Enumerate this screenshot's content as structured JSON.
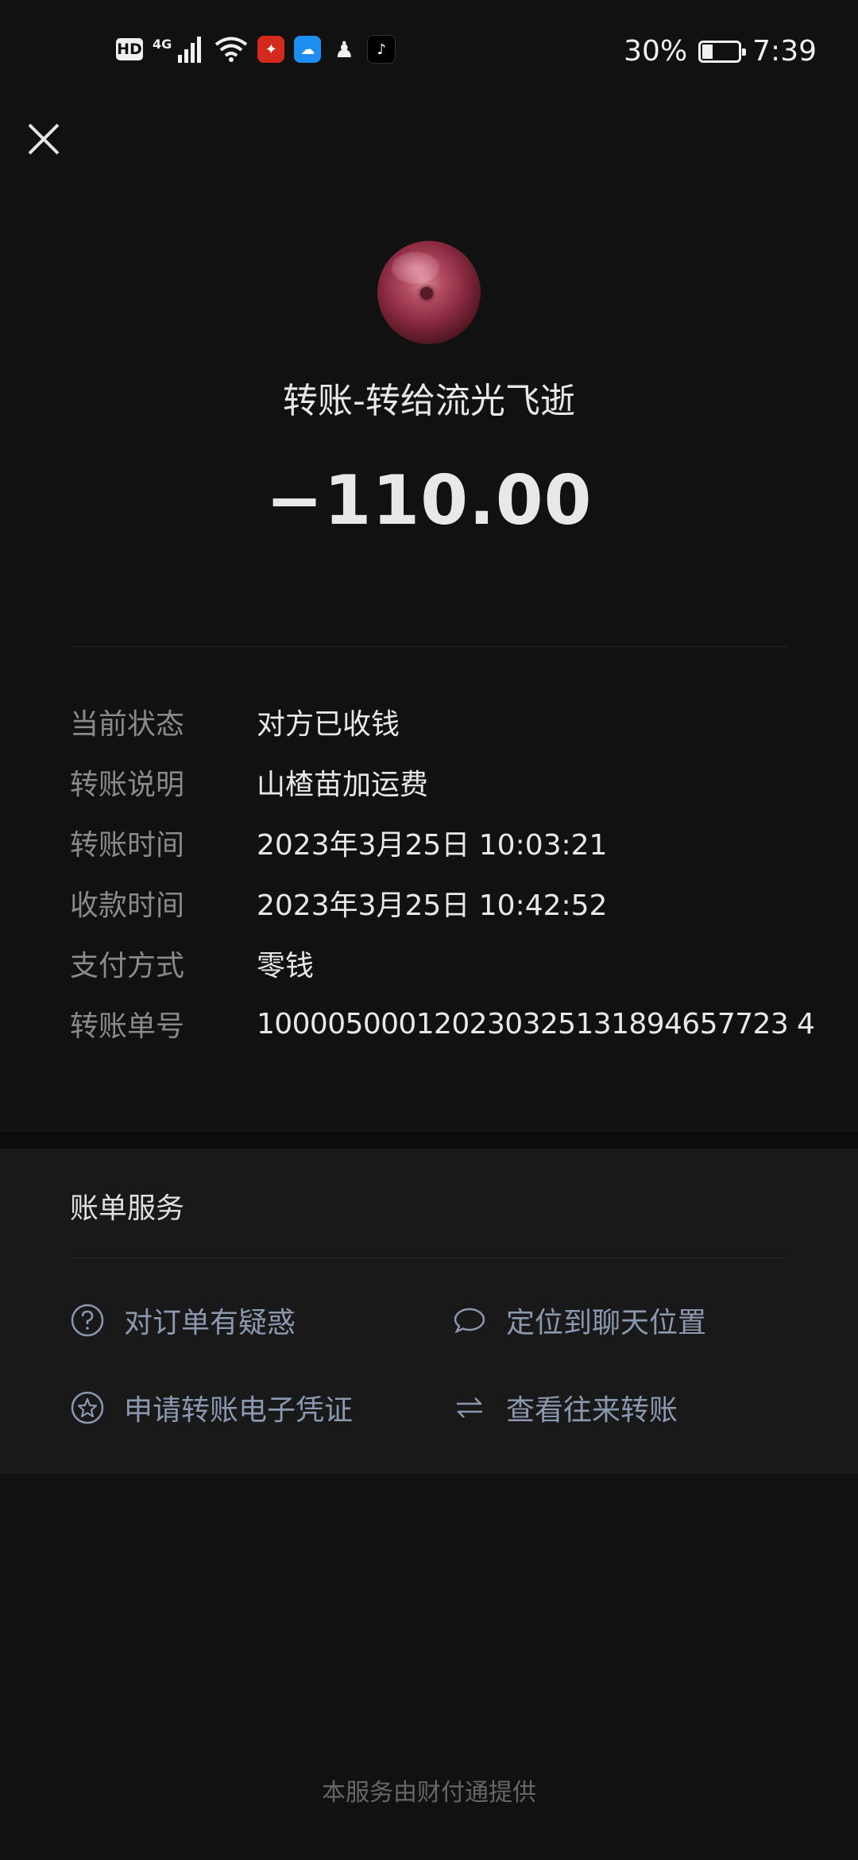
{
  "status_bar": {
    "hd": "HD",
    "network": "4G",
    "battery": "30%",
    "battery_level": 0.3,
    "time": "7:39"
  },
  "header": {
    "close_icon": "close-icon",
    "title": "转账-转给流光飞逝",
    "amount": "−110.00"
  },
  "details": [
    {
      "label": "当前状态",
      "value": "对方已收钱"
    },
    {
      "label": "转账说明",
      "value": "山楂苗加运费"
    },
    {
      "label": "转账时间",
      "value": "2023年3月25日 10:03:21"
    },
    {
      "label": "收款时间",
      "value": "2023年3月25日 10:42:52"
    },
    {
      "label": "支付方式",
      "value": "零钱"
    },
    {
      "label": "转账单号",
      "value": "100005000120230325131894657723 4"
    }
  ],
  "services": {
    "title": "账单服务",
    "items": [
      {
        "label": "对订单有疑惑",
        "icon": "question-circle-icon"
      },
      {
        "label": "定位到聊天位置",
        "icon": "chat-bubble-icon"
      },
      {
        "label": "申请转账电子凭证",
        "icon": "star-circle-icon"
      },
      {
        "label": "查看往来转账",
        "icon": "swap-arrows-icon"
      }
    ]
  },
  "footer": "本服务由财付通提供",
  "colors": {
    "background": "#111111",
    "panel": "#191919",
    "service_text": "#8a98b0",
    "label_text": "#8a8a8a"
  }
}
